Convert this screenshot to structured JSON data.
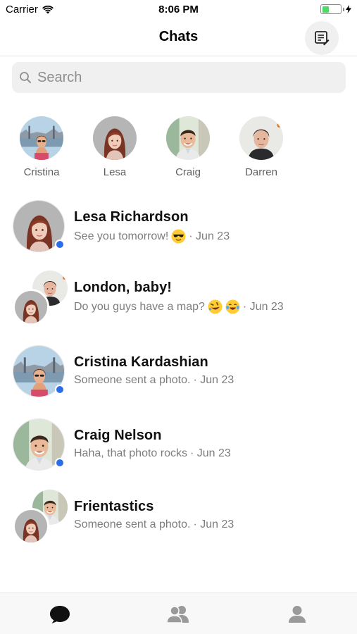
{
  "status_bar": {
    "carrier": "Carrier",
    "time": "8:06 PM",
    "battery_level": 0.45
  },
  "nav": {
    "title": "Chats",
    "compose_icon": "compose-icon"
  },
  "search": {
    "placeholder": "Search",
    "icon": "search-icon"
  },
  "stories": [
    {
      "name": "Cristina",
      "photo": "woman-sunglasses-bridge"
    },
    {
      "name": "Lesa",
      "photo": "woman-red-hair"
    },
    {
      "name": "Craig",
      "photo": "man-smiling"
    },
    {
      "name": "Darren",
      "photo": "man-dark-hair"
    }
  ],
  "chats": [
    {
      "name": "Lesa Richardson",
      "preview": "See you tomorrow!",
      "emojis": [
        "sunglasses-emoji"
      ],
      "date": "· Jun 23",
      "online": true,
      "group": false
    },
    {
      "name": "London, baby!",
      "preview": "Do you guys have a map?",
      "emojis": [
        "rofl-emoji",
        "tears-of-joy-emoji"
      ],
      "date": "· Jun 23",
      "online": false,
      "group": true
    },
    {
      "name": "Cristina Kardashian",
      "preview": "Someone sent a photo.",
      "emojis": [],
      "date": "· Jun 23",
      "online": true,
      "group": false
    },
    {
      "name": "Craig Nelson",
      "preview": "Haha, that photo rocks",
      "emojis": [],
      "date": "· Jun 23",
      "online": true,
      "group": false
    },
    {
      "name": "Frientastics",
      "preview": "Someone sent a photo.",
      "emojis": [],
      "date": "· Jun 23",
      "online": false,
      "group": true
    }
  ],
  "tabbar": {
    "tabs": [
      "chat-bubble-icon",
      "people-icon",
      "profile-icon"
    ],
    "active": 0,
    "active_color": "#111111",
    "inactive_color": "#9a9a9a"
  },
  "colors": {
    "online_dot": "#2d6ee8",
    "battery": "#4cd964"
  }
}
